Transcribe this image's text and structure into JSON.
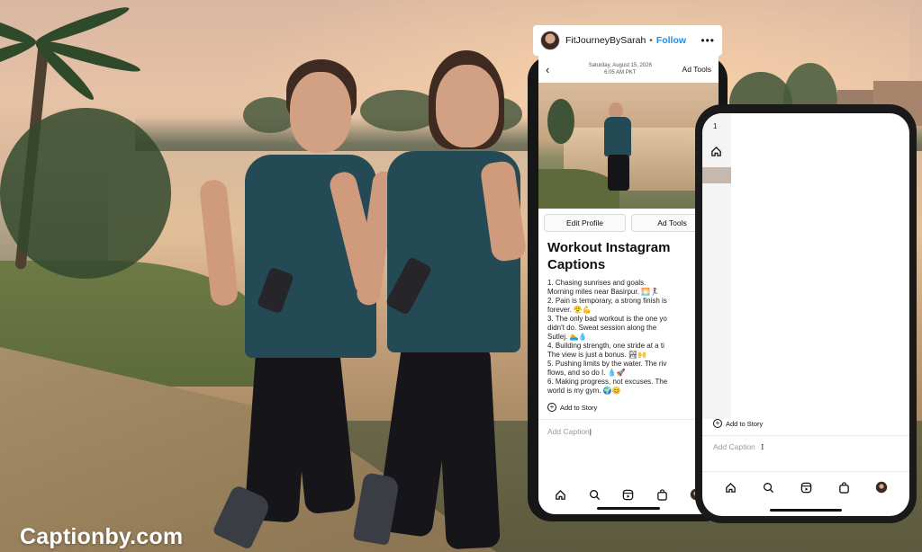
{
  "watermark": "Captionby.com",
  "post_header": {
    "username": "FitJourneyBySarah",
    "separator": "•",
    "follow_label": "Follow",
    "more_glyph": "•••"
  },
  "phone1": {
    "topbar": {
      "back_glyph": "‹",
      "date": "Saturday, August 15, 2026",
      "time": "6:05 AM PKT",
      "ad_tools": "Ad Tools"
    },
    "buttons": {
      "edit_profile": "Edit Profile",
      "ad_tools": "Ad Tools"
    },
    "caption_title": "Workout Instagram Captions",
    "captions": [
      "1. Chasing sunrises and goals.",
      "Morning miles near Basirpur. 🌅🏃‍♀️",
      "2. Pain is temporary, a strong finish is",
      "forever. 😤💪",
      "3. The only bad workout is the one yo",
      "didn't do. Sweat session along the",
      "Sutlej. 🏊💧",
      "4. Building strength, one stride at a ti",
      "The view is just a bonus. 🏞🙌",
      "5. Pushing limits by the water. The riv",
      "flows, and so do I. 💧🚀",
      "6. Making progress, not excuses. The",
      "world is my gym. 🌍😊"
    ],
    "add_to_story": "Add to Story",
    "add_caption_placeholder": "Add Caption"
  },
  "phone2": {
    "time": "1",
    "add_to_story": "Add to Story",
    "add_caption_placeholder": "Add Caption"
  },
  "icons": {
    "nav": [
      "home-icon",
      "search-icon",
      "reels-icon",
      "shop-icon",
      "profile-avatar"
    ]
  },
  "colors": {
    "follow_blue": "#1b8ee6",
    "tank_teal": "#244a55",
    "phone_frame": "#161616"
  }
}
